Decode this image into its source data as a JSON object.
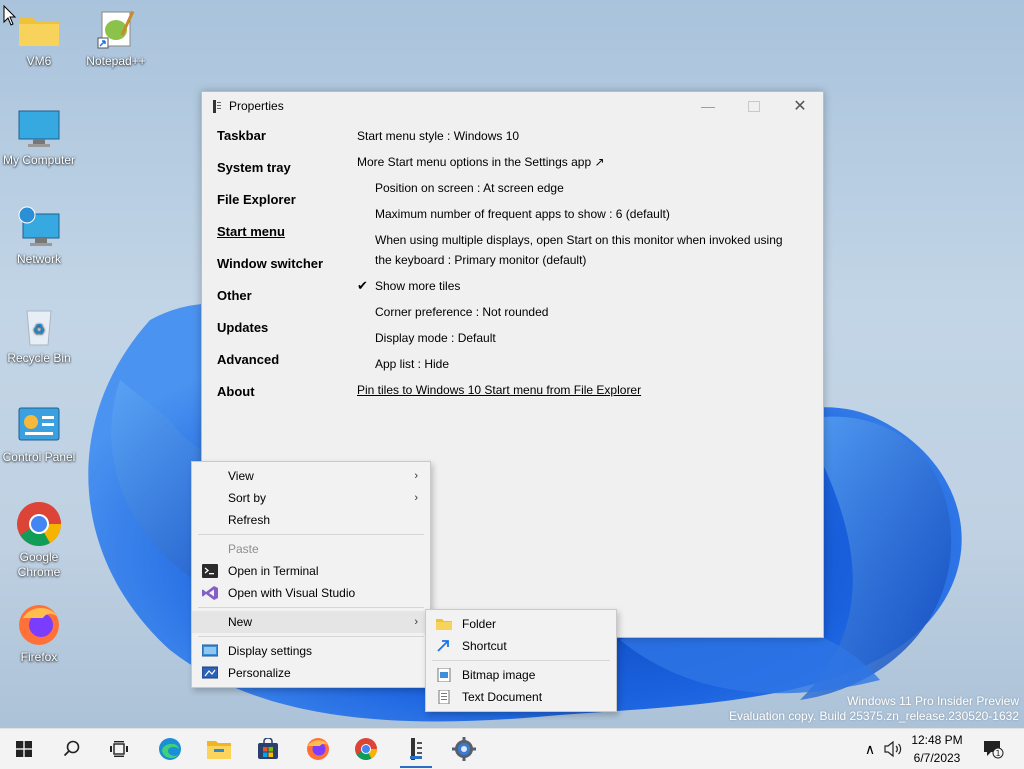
{
  "desktop": {
    "icons": [
      {
        "label": "VM6",
        "icon": "folder-icon"
      },
      {
        "label": "Notepad++",
        "icon": "notepad-plus-plus-icon"
      },
      {
        "label": "My Computer",
        "icon": "monitor-icon"
      },
      {
        "label": "Network",
        "icon": "network-icon"
      },
      {
        "label": "Recycle Bin",
        "icon": "recycle-bin-icon"
      },
      {
        "label": "Control Panel",
        "icon": "control-panel-icon"
      },
      {
        "label": "Google Chrome",
        "icon": "chrome-icon"
      },
      {
        "label": "Firefox",
        "icon": "firefox-icon"
      }
    ],
    "watermark": {
      "line1": "Windows 11 Pro Insider Preview",
      "line2": "Evaluation copy. Build 25375.zn_release.230520-1632"
    }
  },
  "window": {
    "title": "Properties",
    "nav": [
      "Taskbar",
      "System tray",
      "File Explorer",
      "Start menu",
      "Window switcher",
      "Other",
      "Updates",
      "Advanced",
      "About"
    ],
    "active_nav": "Start menu",
    "content": {
      "start_menu_style": "Start menu style : Windows 10",
      "more_options": "More Start menu options in the Settings app ↗",
      "position": "Position on screen : At screen edge",
      "max_frequent": "Maximum number of frequent apps to show : 6 (default)",
      "multi_display_1": "When using multiple displays, open Start on this monitor when invoked using",
      "multi_display_2": "the keyboard : Primary monitor (default)",
      "check_mark": "✔",
      "show_more_tiles": "Show more tiles",
      "corner_pref": "Corner preference : Not rounded",
      "display_mode": "Display mode : Default",
      "app_list": "App list : Hide",
      "pin_tiles_link": "Pin tiles to Windows 10 Start menu from File Explorer"
    }
  },
  "context_menu": {
    "view": "View",
    "sort_by": "Sort by",
    "refresh": "Refresh",
    "paste": "Paste",
    "open_terminal": "Open in Terminal",
    "open_vs": "Open with Visual Studio",
    "new": "New",
    "display_settings": "Display settings",
    "personalize": "Personalize",
    "arrow": "›"
  },
  "new_submenu": {
    "folder": "Folder",
    "shortcut": "Shortcut",
    "bitmap": "Bitmap image",
    "text_doc": "Text Document"
  },
  "taskbar": {
    "time": "12:48 PM",
    "date": "6/7/2023",
    "notification_count": "1",
    "tray_up_arrow": "∧"
  },
  "colors": {
    "accent": "#2a6ec7",
    "window_bg": "#f0f0f0",
    "menu_bg": "#f2f2f2"
  }
}
